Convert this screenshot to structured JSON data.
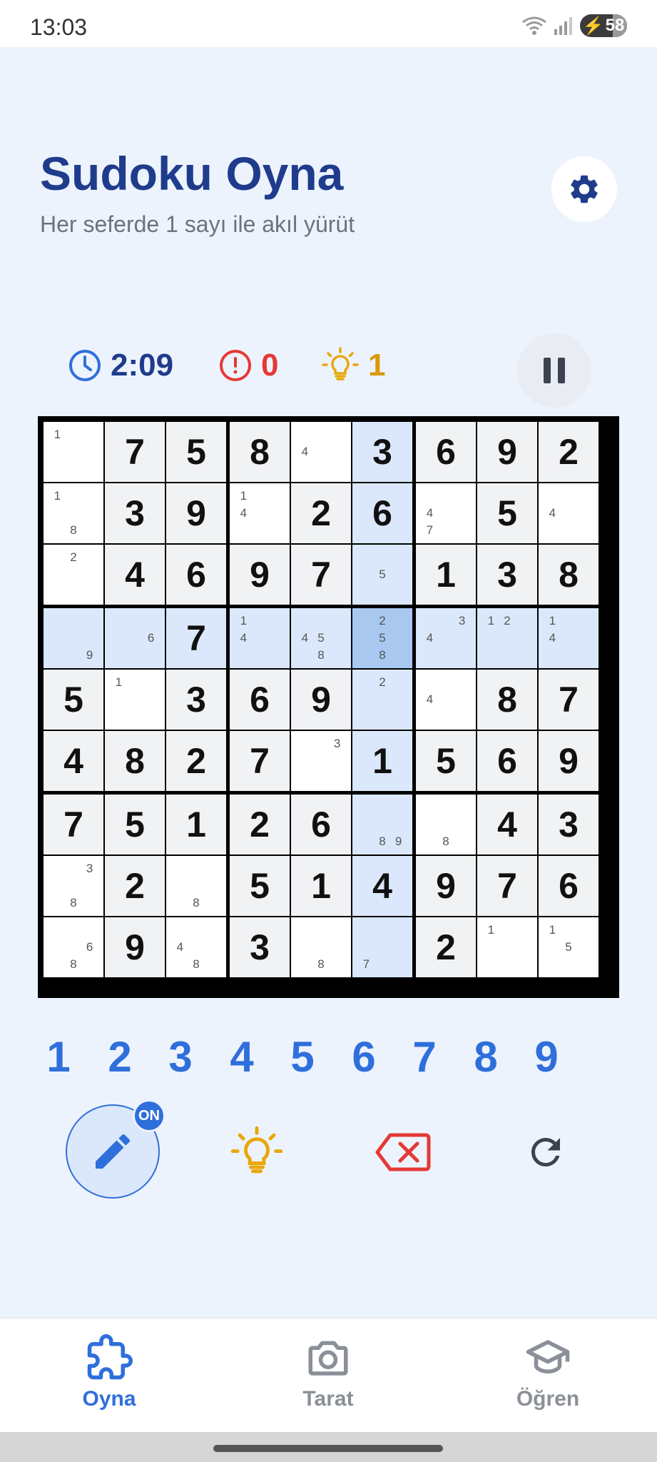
{
  "status_bar": {
    "time": "13:03",
    "battery": "58"
  },
  "header": {
    "title": "Sudoku Oyna",
    "subtitle": "Her seferde 1 sayı ile akıl yürüt"
  },
  "stats": {
    "timer": "2:09",
    "errors": "0",
    "hints": "1"
  },
  "colors": {
    "accent": "#2f6fdb",
    "title": "#1f3c8c",
    "error": "#e53935",
    "hint": "#d99a0b",
    "highlight": "#dbe8fb",
    "selected": "#a8c8f0",
    "given_bg": "#f1f2f4"
  },
  "grid": [
    [
      {
        "n": [
          "1"
        ]
      },
      {
        "v": "7",
        "g": 1
      },
      {
        "v": "5",
        "g": 1
      },
      {
        "v": "8",
        "g": 1
      },
      {
        "n": [
          "4"
        ]
      },
      {
        "v": "3",
        "g": 1
      },
      {
        "v": "6",
        "g": 1
      },
      {
        "v": "9",
        "g": 1
      },
      {
        "v": "2",
        "g": 1
      }
    ],
    [
      {
        "n": [
          "1",
          "8"
        ]
      },
      {
        "v": "3",
        "g": 1
      },
      {
        "v": "9",
        "g": 1
      },
      {
        "n": [
          "1",
          "4"
        ]
      },
      {
        "v": "2",
        "g": 1
      },
      {
        "v": "6",
        "g": 1
      },
      {
        "n": [
          "4",
          "7"
        ]
      },
      {
        "v": "5",
        "g": 1
      },
      {
        "n": [
          "4"
        ]
      }
    ],
    [
      {
        "n": [
          "2"
        ]
      },
      {
        "v": "4",
        "g": 1
      },
      {
        "v": "6",
        "g": 1
      },
      {
        "v": "9",
        "g": 1
      },
      {
        "v": "7",
        "g": 1
      },
      {
        "n": [
          "5"
        ]
      },
      {
        "v": "1",
        "g": 1
      },
      {
        "v": "3",
        "g": 1
      },
      {
        "v": "8",
        "g": 1
      }
    ],
    [
      {
        "n": [
          "9"
        ]
      },
      {
        "n": [
          "6"
        ]
      },
      {
        "v": "7",
        "g": 1
      },
      {
        "n": [
          "1",
          "4"
        ]
      },
      {
        "n": [
          "4",
          "5",
          "8"
        ]
      },
      {
        "n": [
          "2",
          "5",
          "8"
        ]
      },
      {
        "n": [
          "3",
          "4"
        ]
      },
      {
        "n": [
          "1",
          "2"
        ]
      },
      {
        "n": [
          "1",
          "4"
        ]
      }
    ],
    [
      {
        "v": "5",
        "g": 1
      },
      {
        "n": [
          "1"
        ]
      },
      {
        "v": "3",
        "g": 1
      },
      {
        "v": "6",
        "g": 1
      },
      {
        "v": "9",
        "g": 1
      },
      {
        "n": [
          "2"
        ]
      },
      {
        "n": [
          "4"
        ]
      },
      {
        "v": "8",
        "g": 1
      },
      {
        "v": "7",
        "g": 1
      }
    ],
    [
      {
        "v": "4",
        "g": 1
      },
      {
        "v": "8",
        "g": 1
      },
      {
        "v": "2",
        "g": 1
      },
      {
        "v": "7",
        "g": 1
      },
      {
        "n": [
          "3"
        ]
      },
      {
        "v": "1",
        "g": 1
      },
      {
        "v": "5",
        "g": 1
      },
      {
        "v": "6",
        "g": 1
      },
      {
        "v": "9",
        "g": 1
      }
    ],
    [
      {
        "v": "7",
        "g": 1
      },
      {
        "v": "5",
        "g": 1
      },
      {
        "v": "1",
        "g": 1
      },
      {
        "v": "2",
        "g": 1
      },
      {
        "v": "6",
        "g": 1
      },
      {
        "n": [
          "8",
          "9"
        ]
      },
      {
        "n": [
          "8"
        ]
      },
      {
        "v": "4",
        "g": 1
      },
      {
        "v": "3",
        "g": 1
      }
    ],
    [
      {
        "n": [
          "3",
          "8"
        ]
      },
      {
        "v": "2",
        "g": 1
      },
      {
        "n": [
          "8"
        ]
      },
      {
        "v": "5",
        "g": 1
      },
      {
        "v": "1",
        "g": 1
      },
      {
        "v": "4",
        "g": 1
      },
      {
        "v": "9",
        "g": 1
      },
      {
        "v": "7",
        "g": 1
      },
      {
        "v": "6",
        "g": 1
      }
    ],
    [
      {
        "n": [
          "6",
          "8"
        ]
      },
      {
        "v": "9",
        "g": 1
      },
      {
        "n": [
          "4",
          "8"
        ]
      },
      {
        "v": "3",
        "g": 1
      },
      {
        "n": [
          "8"
        ]
      },
      {
        "n": [
          "7"
        ]
      },
      {
        "v": "2",
        "g": 1
      },
      {
        "n": [
          "1"
        ]
      },
      {
        "n": [
          "1",
          "5"
        ]
      }
    ]
  ],
  "selected": {
    "row": 3,
    "col": 5
  },
  "numpad": [
    "1",
    "2",
    "3",
    "4",
    "5",
    "6",
    "7",
    "8",
    "9"
  ],
  "tools": {
    "pencil_badge": "ON"
  },
  "nav": [
    {
      "label": "Oyna",
      "icon": "puzzle-icon",
      "active": true
    },
    {
      "label": "Tarat",
      "icon": "camera-icon",
      "active": false
    },
    {
      "label": "Öğren",
      "icon": "graduation-cap-icon",
      "active": false
    }
  ]
}
